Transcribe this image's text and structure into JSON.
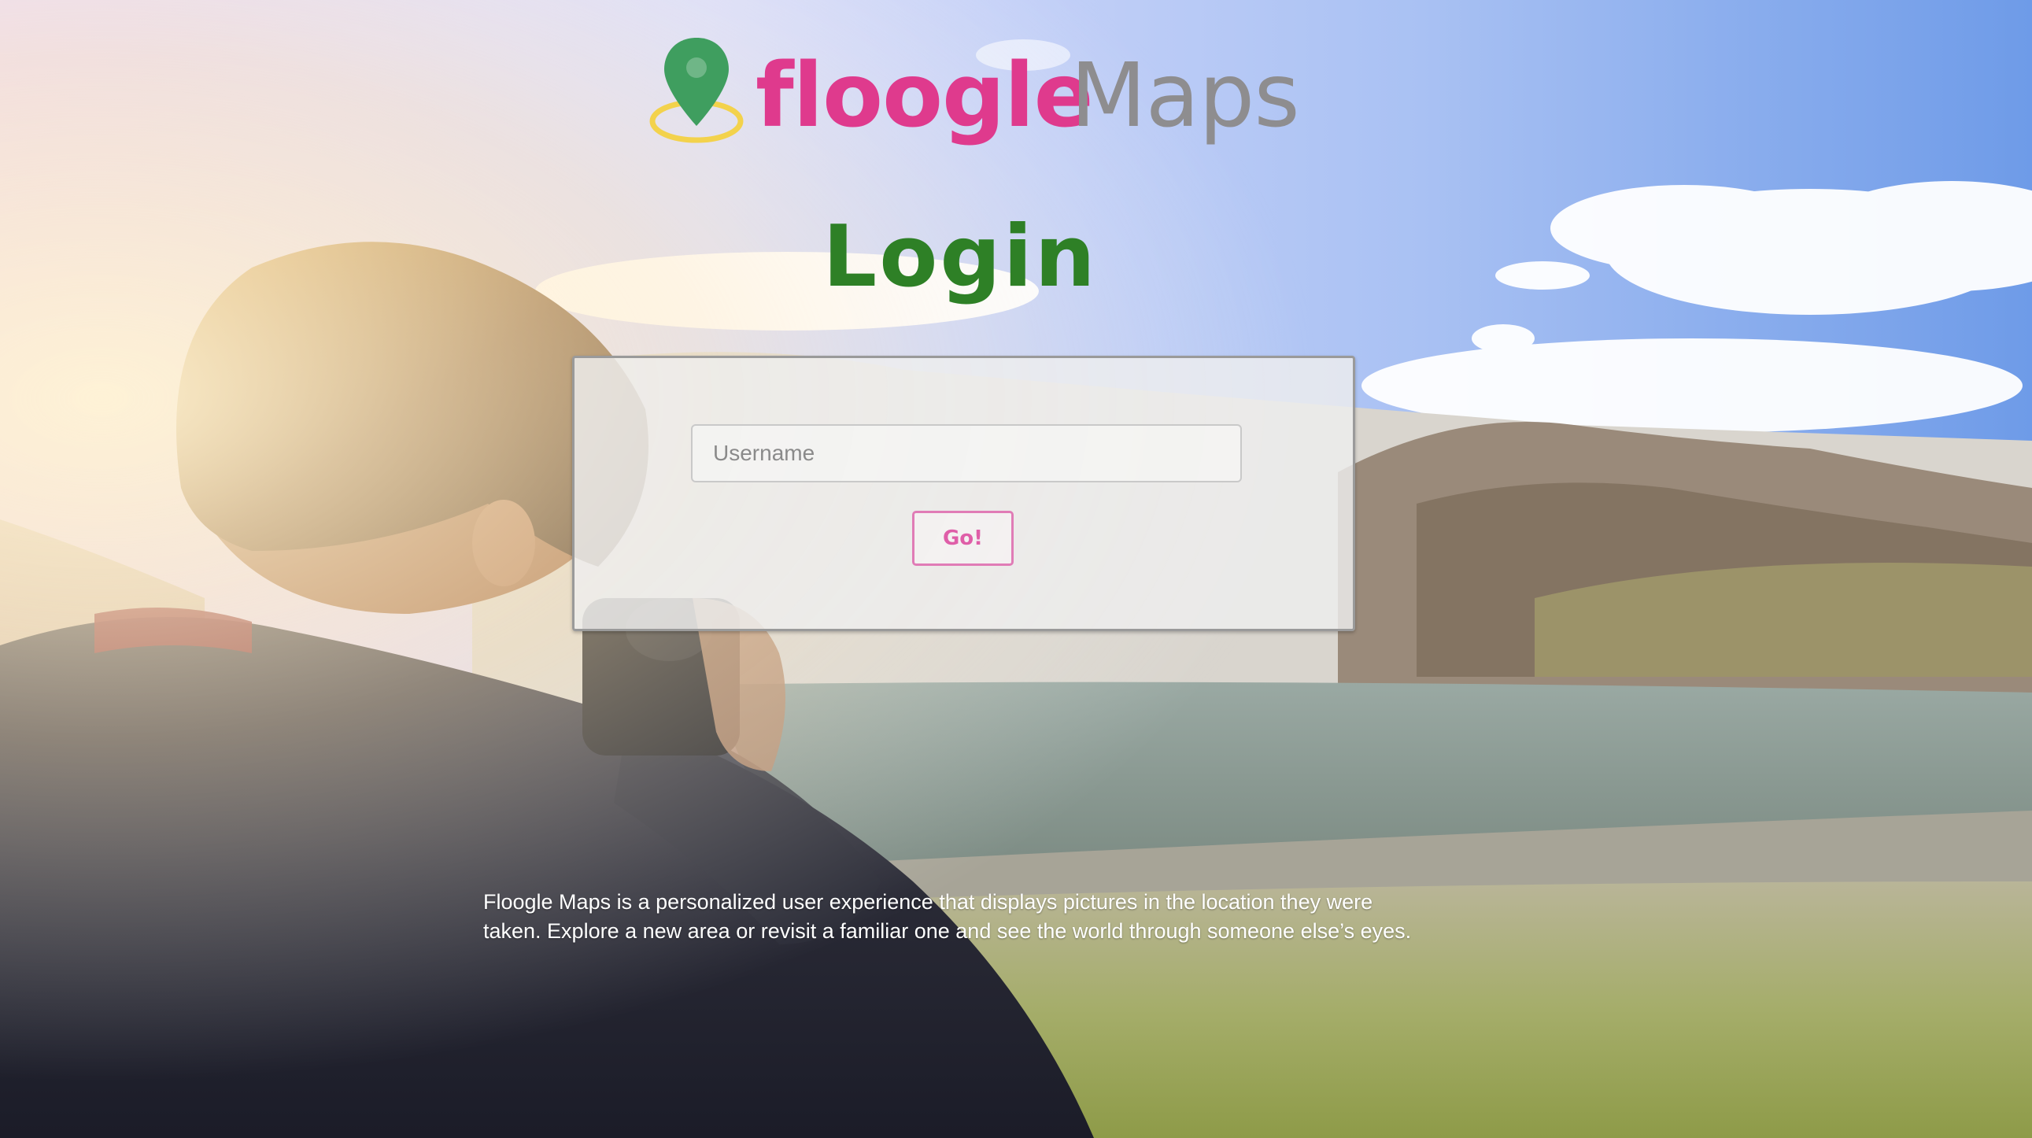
{
  "brand": {
    "name_part1": "floogle",
    "name_part2": "Maps",
    "colors": {
      "floogle": "#df3a8d",
      "maps": "#8e8d8f",
      "pin": "#3f9e5f",
      "pin_ring": "#f3d24c"
    },
    "icon": "map-pin-icon"
  },
  "page": {
    "title": "Login",
    "title_color": "#2e8026"
  },
  "login_form": {
    "username_placeholder": "Username",
    "username_value": "",
    "submit_label": "Go!",
    "submit_color": "#df5ea8"
  },
  "description": {
    "line1": "Floogle Maps is a personalized user experience that displays pictures in the location they were",
    "line2": "taken. Explore a new area or revisit a familiar one and see the world through someone else’s eyes."
  },
  "background": {
    "subject": "photographer-by-lake-landscape"
  }
}
